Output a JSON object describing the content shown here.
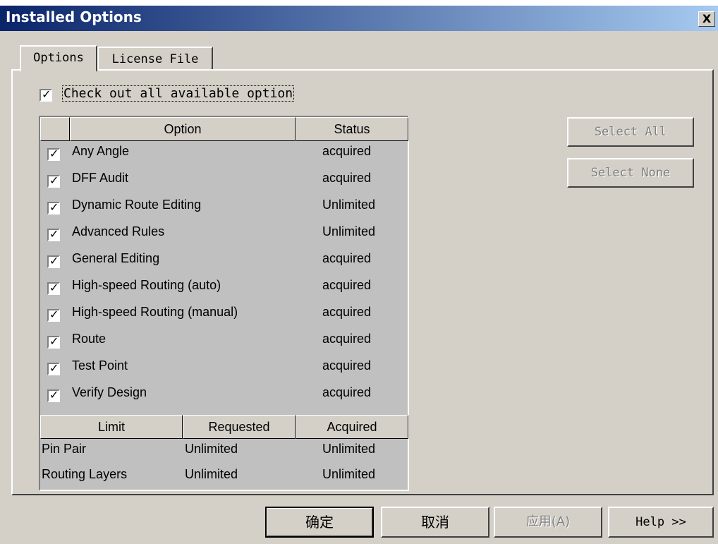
{
  "window": {
    "title": "Installed Options",
    "close_label": "X"
  },
  "tabs": [
    {
      "label": "Options",
      "active": true
    },
    {
      "label": "License File",
      "active": false
    }
  ],
  "master_checkbox": {
    "label": "Check out all available option",
    "checked": true
  },
  "options_table": {
    "headers": [
      "",
      "Option",
      "Status"
    ],
    "rows": [
      {
        "option": "Any Angle",
        "status": "acquired",
        "checked": true
      },
      {
        "option": "DFF Audit",
        "status": "acquired",
        "checked": true
      },
      {
        "option": "Dynamic Route Editing",
        "status": "Unlimited",
        "checked": true
      },
      {
        "option": "Advanced Rules",
        "status": "Unlimited",
        "checked": true
      },
      {
        "option": "General Editing",
        "status": "acquired",
        "checked": true
      },
      {
        "option": "High-speed Routing (auto)",
        "status": "acquired",
        "checked": true
      },
      {
        "option": "High-speed Routing (manual)",
        "status": "acquired",
        "checked": true
      },
      {
        "option": "Route",
        "status": "acquired",
        "checked": true
      },
      {
        "option": "Test Point",
        "status": "acquired",
        "checked": true
      },
      {
        "option": "Verify Design",
        "status": "acquired",
        "checked": true
      }
    ]
  },
  "limits_table": {
    "headers": [
      "Limit",
      "Requested",
      "Acquired"
    ],
    "rows": [
      {
        "limit": "Pin Pair",
        "requested": "Unlimited",
        "acquired": "Unlimited"
      },
      {
        "limit": "Routing Layers",
        "requested": "Unlimited",
        "acquired": "Unlimited"
      }
    ]
  },
  "side_buttons": {
    "select_all": "Select All",
    "select_none": "Select None"
  },
  "footer_buttons": {
    "ok": "确定",
    "cancel": "取消",
    "apply": "应用(A)",
    "help": "Help >>"
  }
}
